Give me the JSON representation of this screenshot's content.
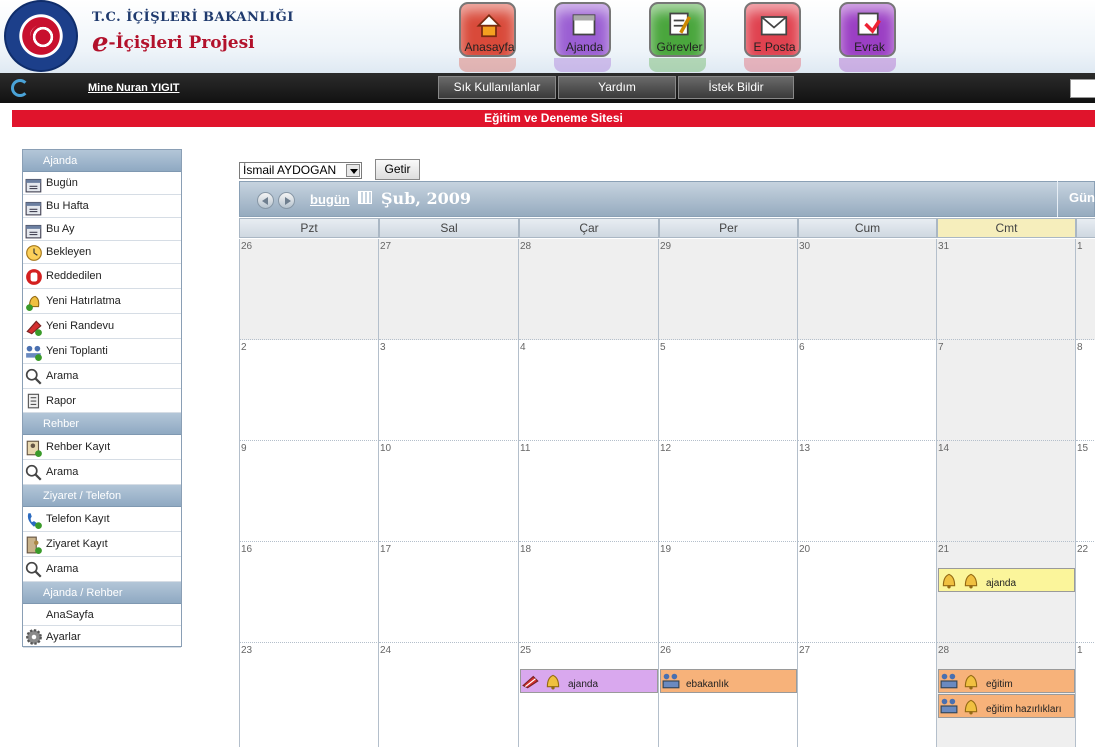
{
  "header": {
    "ministry": "T.C. İÇİŞLERİ BAKANLIĞI",
    "project_e": "e",
    "project": "-İçişleri Projesi",
    "icons": [
      {
        "name": "anasayfa",
        "label": "Anasayfa",
        "color": "#d94a3a",
        "icon": "house-icon"
      },
      {
        "name": "ajanda",
        "label": "Ajanda",
        "color": "#9b5fd3",
        "icon": "calendar-icon"
      },
      {
        "name": "gorevler",
        "label": "Görevler",
        "color": "#4aa63d",
        "icon": "tasks-icon"
      },
      {
        "name": "eposta",
        "label": "E Posta",
        "color": "#e0424f",
        "icon": "envelope-icon"
      },
      {
        "name": "evrak",
        "label": "Evrak",
        "color": "#9b3fc4",
        "icon": "document-icon"
      }
    ]
  },
  "navbar": {
    "user": "Mine Nuran YIGIT",
    "buttons": [
      "Sık Kullanılanlar",
      "Yardım",
      "İstek Bildir"
    ]
  },
  "site_title": "Eğitim ve Deneme Sitesi",
  "sidebar": {
    "sections": [
      {
        "title": "Ajanda",
        "items": [
          {
            "label": "Bugün",
            "icon": "calendar-day-icon"
          },
          {
            "label": "Bu Hafta",
            "icon": "calendar-week-icon"
          },
          {
            "label": "Bu Ay",
            "icon": "calendar-month-icon"
          },
          {
            "label": "Bekleyen",
            "icon": "clock-icon"
          },
          {
            "label": "Reddedilen",
            "icon": "stop-hand-icon"
          },
          {
            "label": "Yeni Hatırlatma",
            "icon": "bell-add-icon"
          },
          {
            "label": "Yeni Randevu",
            "icon": "appointment-add-icon"
          },
          {
            "label": "Yeni Toplanti",
            "icon": "meeting-add-icon"
          },
          {
            "label": "Arama",
            "icon": "magnifier-icon"
          },
          {
            "label": "Rapor",
            "icon": "report-icon"
          }
        ]
      },
      {
        "title": "Rehber",
        "items": [
          {
            "label": "Rehber Kayıt",
            "icon": "contact-add-icon"
          },
          {
            "label": "Arama",
            "icon": "magnifier-icon"
          }
        ]
      },
      {
        "title": "Ziyaret / Telefon",
        "items": [
          {
            "label": "Telefon Kayıt",
            "icon": "phone-icon"
          },
          {
            "label": "Ziyaret Kayıt",
            "icon": "visit-add-icon"
          },
          {
            "label": "Arama",
            "icon": "magnifier-icon"
          }
        ]
      },
      {
        "title": "Ajanda / Rehber",
        "items": [
          {
            "label": "AnaSayfa",
            "icon": ""
          },
          {
            "label": "Ayarlar",
            "icon": "gear-icon"
          }
        ]
      }
    ]
  },
  "calendar": {
    "person": "İsmail AYDOGAN",
    "getir": "Getir",
    "today_link": "bugün",
    "month_title": "Şub, 2009",
    "view_tab": "Gün",
    "day_headers": [
      "Pzt",
      "Sal",
      "Çar",
      "Per",
      "Cum",
      "Cmt"
    ],
    "weeks": [
      [
        "26",
        "27",
        "28",
        "29",
        "30",
        "31",
        "1"
      ],
      [
        "2",
        "3",
        "4",
        "5",
        "6",
        "7",
        "8"
      ],
      [
        "9",
        "10",
        "11",
        "12",
        "13",
        "14",
        "15"
      ],
      [
        "16",
        "17",
        "18",
        "19",
        "20",
        "21",
        "22"
      ],
      [
        "23",
        "24",
        "25",
        "26",
        "27",
        "28",
        "1"
      ]
    ],
    "events": [
      {
        "week": 3,
        "day": 5,
        "slot": 0,
        "label": "ajanda",
        "color": "#fbf59b",
        "icons": [
          "bell-icon",
          "bell-icon"
        ]
      },
      {
        "week": 4,
        "day": 2,
        "slot": 0,
        "label": "ajanda",
        "color": "#d9a8ee",
        "icons": [
          "appointment-icon",
          "bell-icon"
        ]
      },
      {
        "week": 4,
        "day": 3,
        "slot": 0,
        "label": "ebakanlık",
        "color": "#f7b27a",
        "icons": [
          "meeting-icon"
        ]
      },
      {
        "week": 4,
        "day": 5,
        "slot": 0,
        "label": "eğitim",
        "color": "#f7b27a",
        "icons": [
          "meeting-icon",
          "bell-icon"
        ]
      },
      {
        "week": 4,
        "day": 5,
        "slot": 1,
        "label": "eğitim hazırlıkları",
        "color": "#f7b27a",
        "icons": [
          "meeting-icon",
          "bell-icon"
        ]
      }
    ]
  }
}
